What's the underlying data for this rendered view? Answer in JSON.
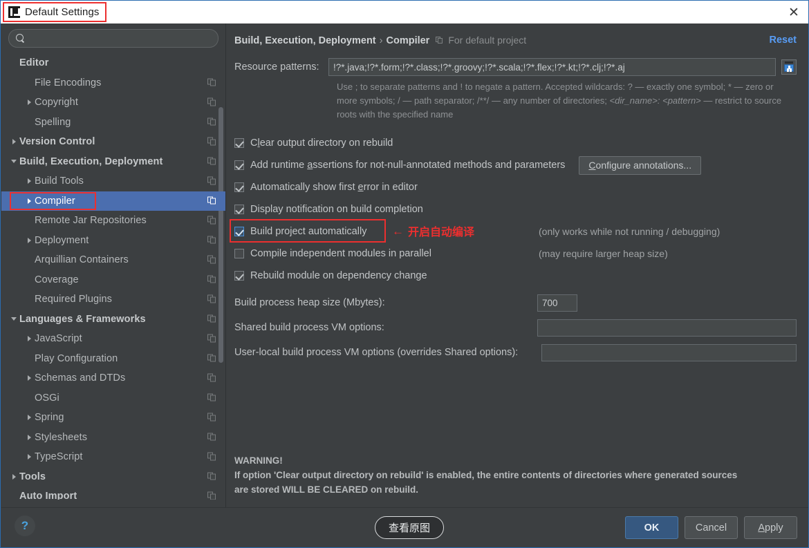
{
  "window": {
    "title": "Default Settings",
    "logo_icon": "intellij-idea-logo",
    "close_icon": "close-icon"
  },
  "sidebar": {
    "search": {
      "value": "",
      "placeholder": "",
      "icon": "search-icon"
    },
    "items": [
      {
        "label": "Editor",
        "indent": 0,
        "arrow": "none",
        "bold": true,
        "copy_icon": false,
        "selected": false
      },
      {
        "label": "File Encodings",
        "indent": 1,
        "arrow": "none",
        "bold": false,
        "copy_icon": true,
        "selected": false
      },
      {
        "label": "Copyright",
        "indent": 1,
        "arrow": "right",
        "bold": false,
        "copy_icon": true,
        "selected": false
      },
      {
        "label": "Spelling",
        "indent": 1,
        "arrow": "none",
        "bold": false,
        "copy_icon": true,
        "selected": false
      },
      {
        "label": "Version Control",
        "indent": 0,
        "arrow": "right",
        "bold": true,
        "copy_icon": true,
        "selected": false
      },
      {
        "label": "Build, Execution, Deployment",
        "indent": 0,
        "arrow": "down",
        "bold": true,
        "copy_icon": true,
        "selected": false
      },
      {
        "label": "Build Tools",
        "indent": 1,
        "arrow": "right",
        "bold": false,
        "copy_icon": true,
        "selected": false
      },
      {
        "label": "Compiler",
        "indent": 1,
        "arrow": "right",
        "bold": false,
        "copy_icon": true,
        "selected": true
      },
      {
        "label": "Remote Jar Repositories",
        "indent": 1,
        "arrow": "none",
        "bold": false,
        "copy_icon": true,
        "selected": false
      },
      {
        "label": "Deployment",
        "indent": 1,
        "arrow": "right",
        "bold": false,
        "copy_icon": true,
        "selected": false
      },
      {
        "label": "Arquillian Containers",
        "indent": 1,
        "arrow": "none",
        "bold": false,
        "copy_icon": true,
        "selected": false
      },
      {
        "label": "Coverage",
        "indent": 1,
        "arrow": "none",
        "bold": false,
        "copy_icon": true,
        "selected": false
      },
      {
        "label": "Required Plugins",
        "indent": 1,
        "arrow": "none",
        "bold": false,
        "copy_icon": true,
        "selected": false
      },
      {
        "label": "Languages & Frameworks",
        "indent": 0,
        "arrow": "down",
        "bold": true,
        "copy_icon": true,
        "selected": false
      },
      {
        "label": "JavaScript",
        "indent": 1,
        "arrow": "right",
        "bold": false,
        "copy_icon": true,
        "selected": false
      },
      {
        "label": "Play Configuration",
        "indent": 1,
        "arrow": "none",
        "bold": false,
        "copy_icon": true,
        "selected": false
      },
      {
        "label": "Schemas and DTDs",
        "indent": 1,
        "arrow": "right",
        "bold": false,
        "copy_icon": true,
        "selected": false
      },
      {
        "label": "OSGi",
        "indent": 1,
        "arrow": "none",
        "bold": false,
        "copy_icon": true,
        "selected": false
      },
      {
        "label": "Spring",
        "indent": 1,
        "arrow": "right",
        "bold": false,
        "copy_icon": true,
        "selected": false
      },
      {
        "label": "Stylesheets",
        "indent": 1,
        "arrow": "right",
        "bold": false,
        "copy_icon": true,
        "selected": false
      },
      {
        "label": "TypeScript",
        "indent": 1,
        "arrow": "right",
        "bold": false,
        "copy_icon": true,
        "selected": false
      },
      {
        "label": "Tools",
        "indent": 0,
        "arrow": "right",
        "bold": true,
        "copy_icon": true,
        "selected": false
      },
      {
        "label": "Auto Import",
        "indent": 0,
        "arrow": "none",
        "bold": true,
        "copy_icon": true,
        "selected": false
      }
    ]
  },
  "content": {
    "breadcrumb": {
      "root": "Build, Execution, Deployment",
      "separator": "›",
      "leaf": "Compiler",
      "scope_icon": "copy-settings-icon",
      "scope_note": "For default project"
    },
    "reset_label": "Reset",
    "resource_patterns": {
      "label": "Resource patterns:",
      "value": "!?*.java;!?*.form;!?*.class;!?*.groovy;!?*.scala;!?*.flex;!?*.kt;!?*.clj;!?*.aj",
      "expand_icon": "expand-field-icon",
      "hint_line1": "Use ; to separate patterns and ! to negate a pattern. Accepted wildcards: ? — exactly one symbol; * — zero or",
      "hint_line2_a": "more symbols; / — path separator; /**/ — any number of directories;  ",
      "hint_line2_i": "<dir_name>: <pattern>",
      "hint_line2_b": " — restrict to",
      "hint_line3": "source roots with the specified name"
    },
    "checkboxes": [
      {
        "label_a": "C",
        "label_u": "l",
        "label_b": "ear output directory on rebuild",
        "checked": true,
        "focused": false,
        "note": ""
      },
      {
        "label_a": "Add runtime ",
        "label_u": "a",
        "label_b": "ssertions for not-null-annotated methods and parameters",
        "checked": true,
        "focused": false,
        "note": ""
      },
      {
        "label_a": "Automatically show first ",
        "label_u": "e",
        "label_b": "rror in editor",
        "checked": true,
        "focused": false,
        "note": ""
      },
      {
        "label_a": "Display notification on build completion",
        "label_u": "",
        "label_b": "",
        "checked": true,
        "focused": false,
        "note": ""
      },
      {
        "label_a": "Build project automatically",
        "label_u": "",
        "label_b": "",
        "checked": true,
        "focused": true,
        "note": "(only works while not running / debugging)"
      },
      {
        "label_a": "Compile independent modules in parallel",
        "label_u": "",
        "label_b": "",
        "checked": false,
        "focused": false,
        "note": "(may require larger heap size)"
      },
      {
        "label_a": "Rebuild module on dependency change",
        "label_u": "",
        "label_b": "",
        "checked": true,
        "focused": false,
        "note": ""
      }
    ],
    "configure_annotations": {
      "label_a": "C",
      "label_u": "",
      "label_b": "onfigure annotations...",
      "underline_char": "C"
    },
    "heap": {
      "label": "Build process heap size (Mbytes):",
      "value": "700"
    },
    "shared_vm": {
      "label": "Shared build process VM options:",
      "value": ""
    },
    "user_vm": {
      "label": "User-local build process VM options (overrides Shared options):",
      "value": ""
    },
    "warning": {
      "title": "WARNING!",
      "line1": "If option 'Clear output directory on rebuild' is enabled, the entire contents of directories where generated sources",
      "line2": "are stored WILL BE CLEARED on rebuild."
    }
  },
  "annotations": {
    "chinese_note": "开启自动编译",
    "arrow_glyph": "←",
    "highlight_color": "#ec2f2f"
  },
  "footer": {
    "help_icon": "help-question-icon",
    "help_label": "?",
    "view_original_label": "查看原图",
    "ok_label": "OK",
    "cancel_label": "Cancel",
    "apply_label_a": "A",
    "apply_label_b": "pply"
  }
}
